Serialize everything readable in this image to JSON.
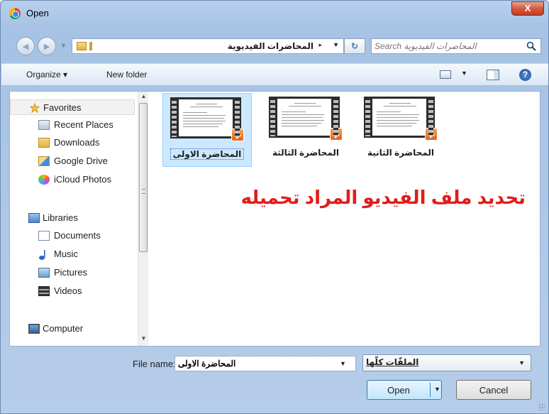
{
  "window": {
    "title": "Open",
    "close_glyph": "X"
  },
  "address_bar": {
    "path": [
      "المحاضرات الفيديوية"
    ],
    "separator": "▸"
  },
  "search": {
    "placeholder": "Search المحاضرات الفيديوية"
  },
  "toolbar": {
    "organize_label": "Organize ▾",
    "new_folder_label": "New folder",
    "help_glyph": "?"
  },
  "nav_pane": {
    "items": [
      {
        "label": "Favorites",
        "icon": "star-icon",
        "selected": true
      },
      {
        "label": "Recent Places",
        "icon": "recent-places-icon"
      },
      {
        "label": "Downloads",
        "icon": "folder-icon"
      },
      {
        "label": "Google Drive",
        "icon": "google-drive-icon"
      },
      {
        "label": "iCloud Photos",
        "icon": "icloud-photos-icon"
      },
      {
        "label": "Libraries",
        "icon": "libraries-icon"
      },
      {
        "label": "Documents",
        "icon": "documents-icon"
      },
      {
        "label": "Music",
        "icon": "music-icon"
      },
      {
        "label": "Pictures",
        "icon": "pictures-icon"
      },
      {
        "label": "Videos",
        "icon": "videos-icon"
      },
      {
        "label": "Computer",
        "icon": "computer-icon"
      }
    ]
  },
  "files": [
    {
      "name": "المحاضرة الاولى",
      "selected": true
    },
    {
      "name": "المحاضرة الثالثة",
      "selected": false
    },
    {
      "name": "المحاضرة الثانية",
      "selected": false
    }
  ],
  "annotation": "تحديد ملف الفيديو المراد تحميله",
  "file_name": {
    "label": "File name:",
    "value": "المحاضرة الاولى"
  },
  "file_type": {
    "value": "الملفّات كلّها"
  },
  "buttons": {
    "open": "Open",
    "cancel": "Cancel"
  },
  "colors": {
    "annotation": "#e31b1b",
    "selection": "#cce8ff",
    "title_bar": "#b8d0ec"
  }
}
